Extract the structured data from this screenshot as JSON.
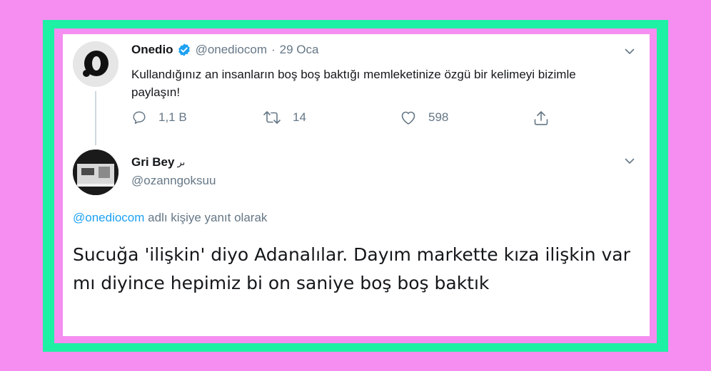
{
  "tweet1": {
    "author_name": "Onedio",
    "handle": "@onediocom",
    "separator": "·",
    "date": "29 Oca",
    "text": "Kullandığınız an insanların boş boş baktığı memleketinize özgü bir kelimeyi bizimle paylaşın!",
    "avatar_letter": "o",
    "replies": "1,1 B",
    "retweets": "14",
    "likes": "598"
  },
  "tweet2": {
    "author_name": "Gri Bey",
    "name_suffix": "ىر",
    "handle": "@ozanngoksuu",
    "reply_link": "@onediocom",
    "reply_rest": " adlı kişiye yanıt olarak",
    "text": "Sucuğa 'ilişkin' diyo Adanalılar. Dayım markette kıza ilişkin var mı diyince hepimiz bi on saniye boş boş baktık"
  },
  "colors": {
    "background_pink": "#f58ef0",
    "frame_green": "#1ef0a4",
    "link_blue": "#1da1f2",
    "muted_gray": "#657786"
  },
  "icons": [
    "verified-badge-icon",
    "chevron-down-icon",
    "reply-icon",
    "retweet-icon",
    "heart-icon",
    "share-icon"
  ]
}
